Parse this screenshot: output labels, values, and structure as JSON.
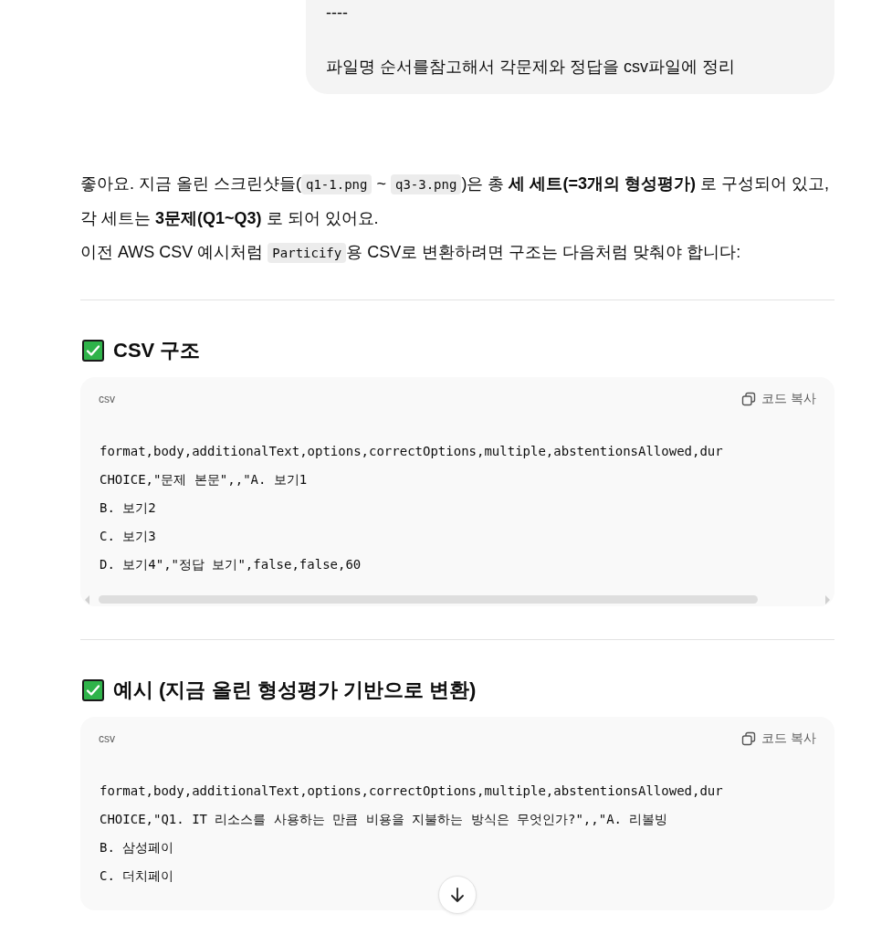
{
  "user_message": {
    "lines": [
      "----",
      "파일명 순서를참고해서 각문제와 정답을 csv파일에 정리"
    ]
  },
  "assistant": {
    "paragraph": [
      {
        "kind": "text",
        "text": "좋아요. 지금 올린 스크린샷들("
      },
      {
        "kind": "code",
        "text": "q1-1.png"
      },
      {
        "kind": "text",
        "text": " ~ "
      },
      {
        "kind": "code",
        "text": "q3-3.png"
      },
      {
        "kind": "text",
        "text": ")은 총 **세 세트(=3개의 형성평가)** 로 구성되어 있고, 각 세트는 **3문제(Q1~Q3)** 로 되어 있어요."
      },
      {
        "kind": "break"
      },
      {
        "kind": "text",
        "text": "이전 AWS CSV 예시처럼 "
      },
      {
        "kind": "code",
        "text": "Particify"
      },
      {
        "kind": "text",
        "text": "용 CSV로 변환하려면 구조는 다음처럼 맞춰야 합니다:"
      }
    ],
    "sections": [
      {
        "heading": "CSV 구조",
        "code_block": {
          "language": "csv",
          "copy_label": "코드 복사",
          "scrollbar_visible": true,
          "lines": [
            "format,body,additionalText,options,correctOptions,multiple,abstentionsAllowed,dur",
            "CHOICE,\"문제 본문\",,\"A. 보기1",
            "B. 보기2",
            "C. 보기3",
            "D. 보기4\",\"정답 보기\",false,false,60"
          ]
        }
      },
      {
        "heading": "예시 (지금 올린 형성평가 기반으로 변환)",
        "code_block": {
          "language": "csv",
          "copy_label": "코드 복사",
          "scrollbar_visible": false,
          "lines": [
            "format,body,additionalText,options,correctOptions,multiple,abstentionsAllowed,dur",
            "CHOICE,\"Q1. IT 리소스를 사용하는 만큼 비용을 지불하는 방식은 무엇인가?\",,\"A. 리볼빙",
            "B. 삼성페이",
            "C. 더치페이"
          ]
        }
      }
    ]
  }
}
